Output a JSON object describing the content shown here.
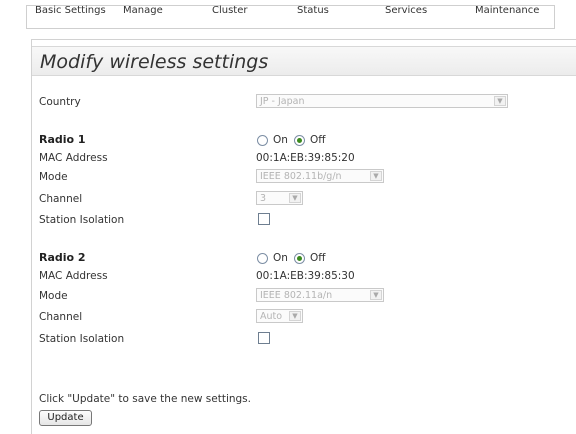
{
  "nav": {
    "tabs": [
      "Basic Settings",
      "Manage",
      "Cluster",
      "Status",
      "Services",
      "Maintenance"
    ]
  },
  "page": {
    "title": "Modify wireless settings"
  },
  "country": {
    "label": "Country",
    "value": "JP - Japan"
  },
  "radio1": {
    "heading": "Radio 1",
    "on_label": "On",
    "off_label": "Off",
    "selected": "Off",
    "mac_label": "MAC Address",
    "mac_value": "00:1A:EB:39:85:20",
    "mode_label": "Mode",
    "mode_value": "IEEE 802.11b/g/n",
    "channel_label": "Channel",
    "channel_value": "3",
    "isolation_label": "Station Isolation",
    "isolation_checked": false
  },
  "radio2": {
    "heading": "Radio 2",
    "on_label": "On",
    "off_label": "Off",
    "selected": "Off",
    "mac_label": "MAC Address",
    "mac_value": "00:1A:EB:39:85:30",
    "mode_label": "Mode",
    "mode_value": "IEEE 802.11a/n",
    "channel_label": "Channel",
    "channel_value": "Auto",
    "isolation_label": "Station Isolation",
    "isolation_checked": false
  },
  "footer": {
    "hint": "Click \"Update\" to save the new settings.",
    "update_label": "Update"
  },
  "icons": {
    "dropdown": "chevron-down-icon",
    "radio_selected_color": "#3b8a1e"
  }
}
